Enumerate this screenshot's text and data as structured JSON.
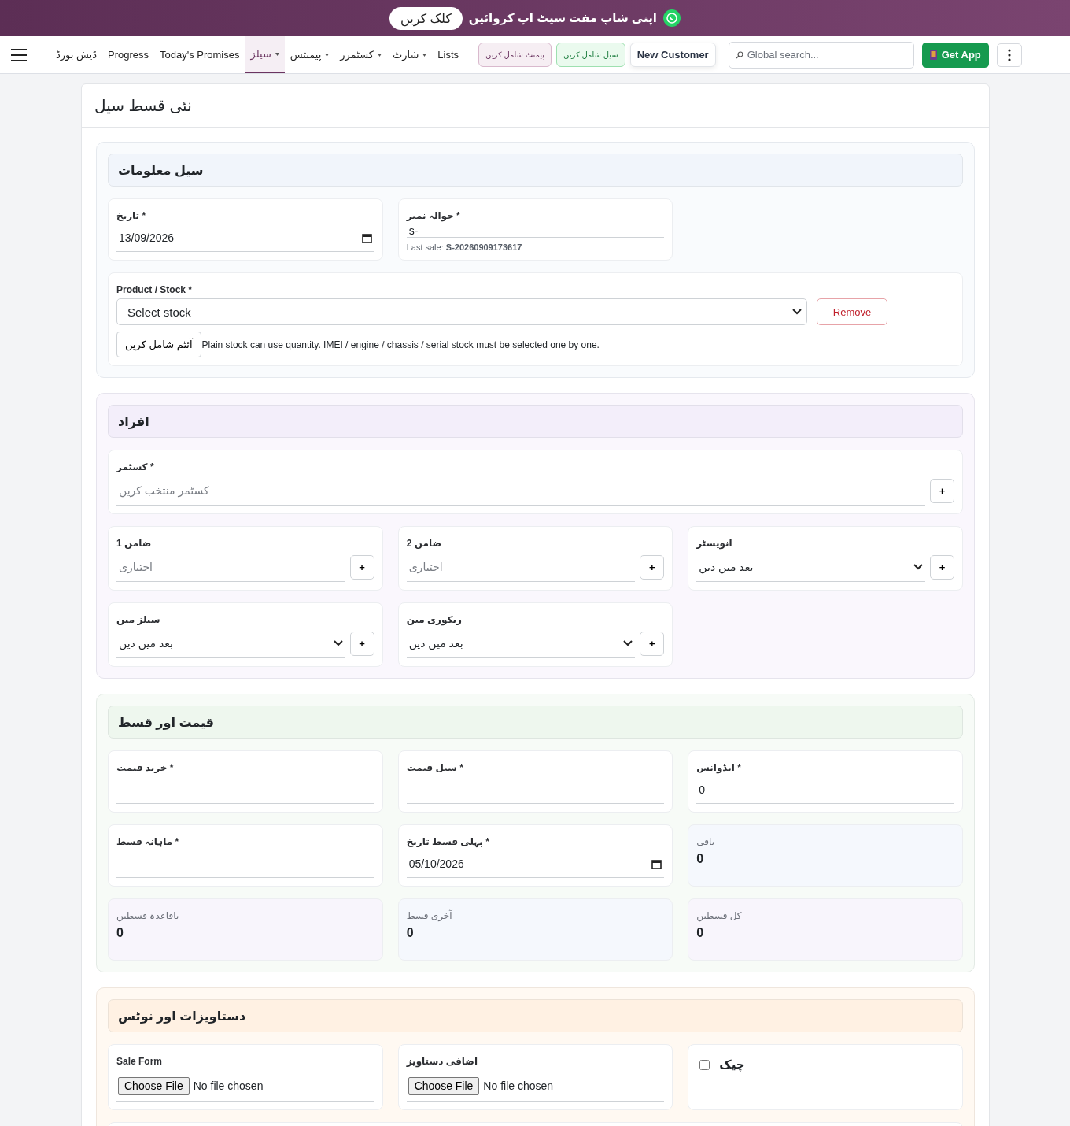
{
  "banner": {
    "text": "اپنی شاپ مفت سیٹ اپ کروائیں",
    "button": "کلک کریں"
  },
  "nav": {
    "items": [
      {
        "label": "Lists",
        "selected": false,
        "dropdown": false
      },
      {
        "label": "شارٹ",
        "selected": false,
        "dropdown": true
      },
      {
        "label": "کسٹمرز",
        "selected": false,
        "dropdown": true
      },
      {
        "label": "پیمنٹس",
        "selected": false,
        "dropdown": true
      },
      {
        "label": "سیلز",
        "selected": true,
        "dropdown": true
      },
      {
        "label": "Today's Promises",
        "selected": false,
        "dropdown": false
      },
      {
        "label": "Progress",
        "selected": false,
        "dropdown": false
      },
      {
        "label": "ڈیش بورڈ",
        "selected": false,
        "dropdown": false
      }
    ],
    "actions": [
      {
        "label": "New Customer",
        "kind": "plain"
      },
      {
        "label": "سیل شامل کریں",
        "kind": "green"
      },
      {
        "label": "پیمنٹ شامل کریں",
        "kind": "pink"
      }
    ],
    "search": {
      "placeholder": "Global search..."
    },
    "get_app": "Get App"
  },
  "page": {
    "title": "نئی قسط سیل"
  },
  "sections": [
    {
      "title": "سیل معلومات",
      "color": "#f1f5fb",
      "rows": [
        {
          "fields": [
            {
              "kind": "text",
              "label": "حوالہ نمبر *",
              "value": "s-",
              "hint": "Last sale: **S-20260909173617**"
            },
            {
              "kind": "date",
              "label": "تاریخ *",
              "value": "13/09/2026"
            }
          ]
        },
        {
          "fields": [
            {
              "kind": "product",
              "label": "Product / Stock *",
              "value": "Select stock",
              "remove": "Remove",
              "add": "آئٹم شامل کریں",
              "note": "Plain stock can use quantity. IMEI / engine / chassis / serial stock must be selected one by one."
            }
          ]
        }
      ]
    },
    {
      "title": "افراد",
      "color": "#f3eefa",
      "rows": [
        {
          "fields": [
            {
              "kind": "lookup",
              "label": "کسٹمر *",
              "placeholder": "کسٹمر منتخب کریں",
              "add": "+"
            }
          ]
        },
        {
          "fields": [
            {
              "kind": "select",
              "label": "انویسٹر",
              "value": "بعد میں دیں",
              "add": "+"
            },
            {
              "kind": "lookup",
              "label": "ضامن 2",
              "placeholder": "اختیاری",
              "add": "+"
            },
            {
              "kind": "lookup",
              "label": "ضامن 1",
              "placeholder": "اختیاری",
              "add": "+"
            }
          ]
        },
        {
          "fields": [
            {
              "kind": "select",
              "label": "ریکوری مین",
              "value": "بعد میں دیں",
              "add": "+"
            },
            {
              "kind": "select",
              "label": "سیلز مین",
              "value": "بعد میں دیں",
              "add": "+"
            }
          ]
        }
      ]
    },
    {
      "title": "قیمت اور قسط",
      "color": "#eef7ee",
      "rows": [
        {
          "fields": [
            {
              "kind": "text",
              "label": "ایڈوانس *",
              "value": "0"
            },
            {
              "kind": "text",
              "label": "سیل قیمت *"
            },
            {
              "kind": "text",
              "label": "خرید قیمت *"
            }
          ]
        },
        {
          "fields": [
            {
              "kind": "summary",
              "label": "باقی",
              "value": "0",
              "color": "#f5f8fd"
            },
            {
              "kind": "date",
              "label": "پہلی قسط تاریخ *",
              "value": "05/10/2026"
            },
            {
              "kind": "text",
              "label": "ماہانہ قسط *"
            }
          ]
        },
        {
          "fields": [
            {
              "kind": "summary",
              "label": "کل قسطیں",
              "value": "0",
              "color": "#f8f5fc"
            },
            {
              "kind": "summary",
              "label": "آخری قسط",
              "value": "0",
              "color": "#f5f8fd"
            },
            {
              "kind": "summary",
              "label": "باقاعدہ قسطیں",
              "value": "0",
              "color": "#f8f5fc"
            }
          ]
        }
      ]
    },
    {
      "title": "دستاویزات اور نوٹس",
      "color": "#fff1e3",
      "rows": [
        {
          "fields": [
            {
              "kind": "checkbox",
              "label": "چیک",
              "checked": false
            },
            {
              "kind": "file",
              "label": "اضافی دستاویز",
              "button": "Choose File",
              "status": "No file chosen"
            },
            {
              "kind": "file",
              "label": "Sale Form",
              "button": "Choose File",
              "status": "No file chosen"
            }
          ]
        }
      ]
    }
  ]
}
